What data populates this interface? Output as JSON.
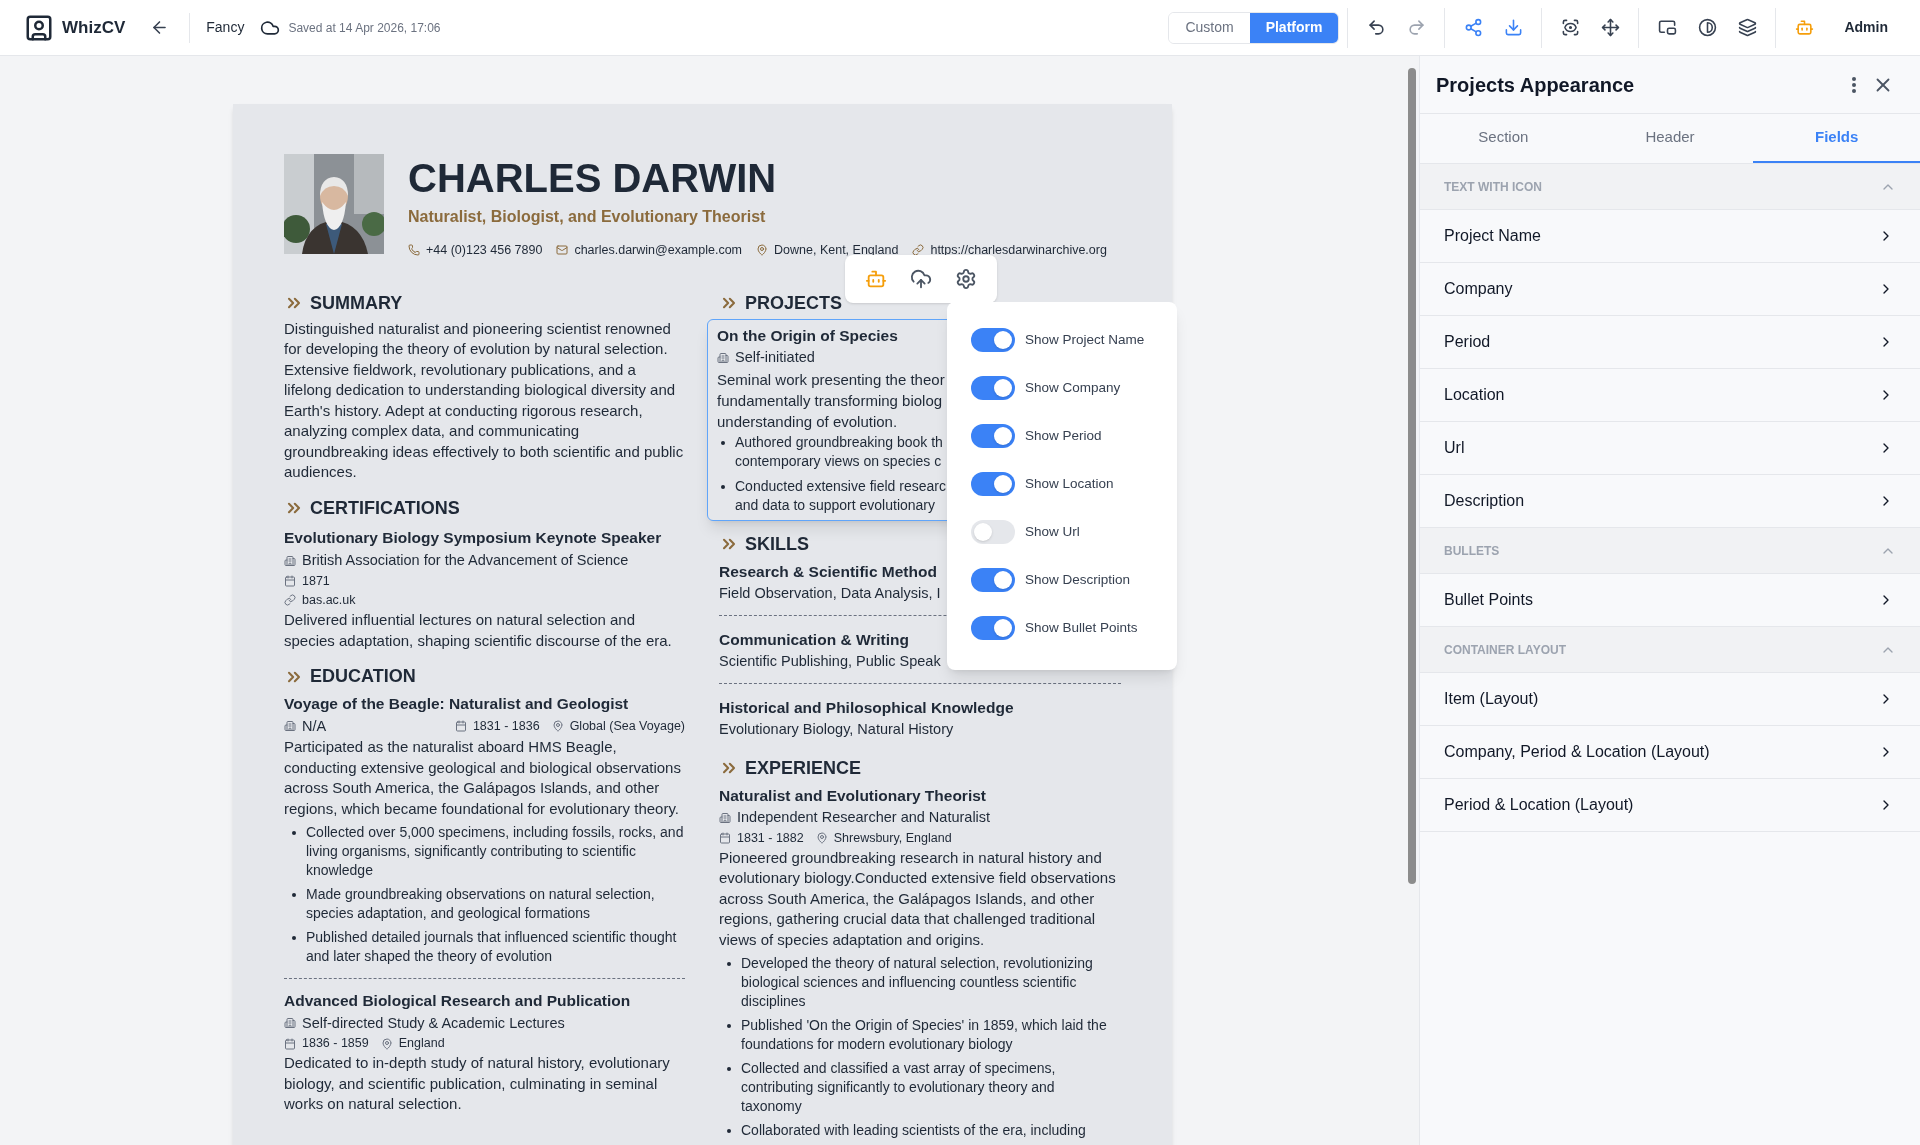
{
  "topbar": {
    "brand": "WhizCV",
    "template": "Fancy",
    "save_status": "Saved at 14 Apr 2026, 17:06",
    "modes": [
      {
        "label": "Custom",
        "selected": false
      },
      {
        "label": "Platform",
        "selected": true
      }
    ],
    "user": "Admin"
  },
  "resume": {
    "name": "CHARLES DARWIN",
    "title": "Naturalist, Biologist, and Evolutionary Theorist",
    "contacts": [
      {
        "kind": "phone",
        "text": "+44 (0)123 456 7890"
      },
      {
        "kind": "email",
        "text": "charles.darwin@example.com"
      },
      {
        "kind": "location",
        "text": "Downe, Kent, England"
      },
      {
        "kind": "link",
        "text": "https://charlesdarwinarchive.org"
      }
    ],
    "summary": {
      "heading": "SUMMARY",
      "text": "Distinguished naturalist and pioneering scientist renowned for developing the theory of evolution by natural selection. Extensive fieldwork, revolutionary publications, and a lifelong dedication to understanding biological diversity and Earth's history. Adept at conducting rigorous research, analyzing complex data, and communicating groundbreaking ideas effectively to both scientific and public audiences."
    },
    "certifications": {
      "heading": "CERTIFICATIONS",
      "items": [
        {
          "title": "Evolutionary Biology Symposium Keynote Speaker",
          "org": "British Association for the Advancement of Science",
          "year": "1871",
          "url": "bas.ac.uk",
          "description": "Delivered influential lectures on natural selection and species adaptation, shaping scientific discourse of the era."
        }
      ]
    },
    "education": {
      "heading": "EDUCATION",
      "items": [
        {
          "title": "Voyage of the Beagle: Naturalist and Geologist",
          "org": "N/A",
          "period": "1831 - 1836",
          "location": "Global (Sea Voyage)",
          "description": "Participated as the naturalist aboard HMS Beagle, conducting extensive geological and biological observations across South America, the Galápagos Islands, and other regions, which became foundational for evolutionary theory.",
          "bullets": [
            "Collected over 5,000 specimens, including fossils, rocks, and living organisms, significantly contributing to scientific knowledge",
            "Made groundbreaking observations on natural selection, species adaptation, and geological formations",
            "Published detailed journals that influenced scientific thought and later shaped the theory of evolution"
          ]
        },
        {
          "title": "Advanced Biological Research and Publication",
          "org": "Self-directed Study & Academic Lectures",
          "period": "1836 - 1859",
          "location": "England",
          "description": "Dedicated to in-depth study of natural history, evolutionary biology, and scientific publication, culminating in seminal works on natural selection."
        }
      ]
    },
    "projects": {
      "heading": "PROJECTS",
      "items": [
        {
          "title": "On the Origin of Species",
          "company": "Self-initiated",
          "description_lines": [
            "Seminal work presenting the theor",
            "fundamentally transforming biolog",
            "understanding of evolution."
          ],
          "bullets": [
            [
              "Authored groundbreaking book th",
              "contemporary views on species c"
            ],
            [
              "Conducted extensive field researc",
              "and data to support evolutionary"
            ]
          ]
        }
      ]
    },
    "skills": {
      "heading": "SKILLS",
      "items": [
        {
          "title": "Research & Scientific Method",
          "text": "Field Observation, Data Analysis, I"
        },
        {
          "title": "Communication & Writing",
          "text": "Scientific Publishing, Public Speak"
        },
        {
          "title": "Historical and Philosophical Knowledge",
          "text": "Evolutionary Biology, Natural History"
        }
      ]
    },
    "experience": {
      "heading": "EXPERIENCE",
      "items": [
        {
          "title": "Naturalist and Evolutionary Theorist",
          "company": "Independent Researcher and Naturalist",
          "period": "1831 - 1882",
          "location": "Shrewsbury, England",
          "description": "Pioneered groundbreaking research in natural history and evolutionary biology.Conducted extensive field observations across South America, the Galápagos Islands, and other regions, gathering crucial data that challenged traditional views of species adaptation and origins.",
          "bullets": [
            "Developed the theory of natural selection, revolutionizing biological sciences and influencing countless scientific disciplines",
            "Published 'On the Origin of Species' in 1859, which laid the foundations for modern evolutionary biology",
            "Collected and classified a vast array of specimens, contributing significantly to evolutionary theory and taxonomy",
            "Collaborated with leading scientists of the era, including"
          ]
        }
      ]
    }
  },
  "toggles": [
    {
      "label": "Show Project Name",
      "on": true
    },
    {
      "label": "Show Company",
      "on": true
    },
    {
      "label": "Show Period",
      "on": true
    },
    {
      "label": "Show Location",
      "on": true
    },
    {
      "label": "Show Url",
      "on": false
    },
    {
      "label": "Show Description",
      "on": true
    },
    {
      "label": "Show Bullet Points",
      "on": true
    }
  ],
  "panel": {
    "title": "Projects Appearance",
    "tabs": [
      {
        "label": "Section",
        "selected": false
      },
      {
        "label": "Header",
        "selected": false
      },
      {
        "label": "Fields",
        "selected": true
      }
    ],
    "groups": [
      {
        "heading": "TEXT WITH ICON",
        "expanded": true,
        "items": [
          "Project Name",
          "Company",
          "Period",
          "Location",
          "Url",
          "Description"
        ]
      },
      {
        "heading": "BULLETS",
        "expanded": true,
        "items": [
          "Bullet Points"
        ]
      },
      {
        "heading": "CONTAINER LAYOUT",
        "expanded": true,
        "items": [
          "Item (Layout)",
          "Company, Period & Location (Layout)",
          "Period & Location (Layout)"
        ]
      }
    ]
  }
}
